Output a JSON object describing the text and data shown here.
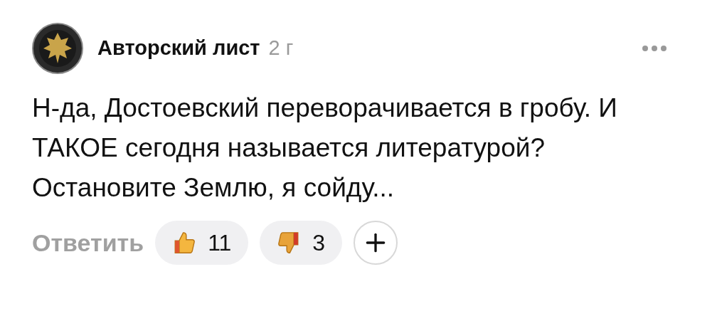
{
  "comment": {
    "author": "Авторский лист",
    "age": "2 г",
    "text": "Н-да, Достоевский переворачивается в гробу. И ТАКОЕ сегодня называется литературой? Остановите Землю, я сойду...",
    "reply": "Ответить",
    "reactions": [
      {
        "kind": "like",
        "count": "11"
      },
      {
        "kind": "dislike",
        "count": "3"
      }
    ]
  }
}
